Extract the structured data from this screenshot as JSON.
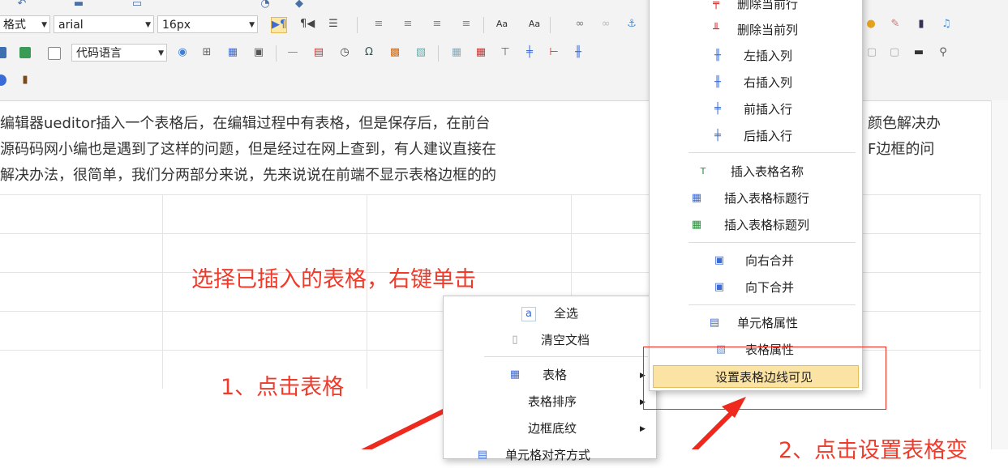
{
  "toolbar": {
    "paragraph_format": "格式",
    "font_family": "arial",
    "font_size": "16px",
    "code_language": "代码语言"
  },
  "editor": {
    "lines": [
      "编辑器ueditor插入一个表格后，在编辑过程中有表格，但是保存后，在前台",
      "源码码网小编也是遇到了这样的问题，但是经过在网上查到，有人建议直接在",
      "解决办法，很简单，我们分两部分来说，先来说说在前端不显示表格边框的的"
    ],
    "right_fragments": [
      "颜色解决办",
      "F边框的问"
    ]
  },
  "annotations": {
    "select_table": "选择已插入的表格，右键单击",
    "step1": "1、点击表格",
    "step2": "2、点击设置表格变"
  },
  "context_menu": {
    "items": [
      {
        "label": "全选",
        "icon": "select-all-icon"
      },
      {
        "label": "清空文档",
        "icon": "document-icon"
      },
      {
        "label": "表格",
        "icon": "table-icon",
        "submenu": true
      },
      {
        "label": "表格排序",
        "submenu": true
      },
      {
        "label": "边框底纹",
        "submenu": true
      },
      {
        "label": "单元格对齐方式",
        "icon": "align-icon"
      }
    ]
  },
  "table_submenu": {
    "items": [
      {
        "label": "删除当前行",
        "icon": "delete-row-icon"
      },
      {
        "label": "删除当前列",
        "icon": "delete-col-icon"
      },
      {
        "label": "左插入列",
        "icon": "insert-col-left-icon"
      },
      {
        "label": "右插入列",
        "icon": "insert-col-right-icon"
      },
      {
        "label": "前插入行",
        "icon": "insert-row-above-icon"
      },
      {
        "label": "后插入行",
        "icon": "insert-row-below-icon"
      },
      {
        "label": "插入表格名称",
        "icon": "insert-caption-icon"
      },
      {
        "label": "插入表格标题行",
        "icon": "insert-title-row-icon"
      },
      {
        "label": "插入表格标题列",
        "icon": "insert-title-col-icon"
      },
      {
        "label": "向右合并",
        "icon": "merge-right-icon"
      },
      {
        "label": "向下合并",
        "icon": "merge-down-icon"
      },
      {
        "label": "单元格属性",
        "icon": "cell-properties-icon"
      },
      {
        "label": "表格属性",
        "icon": "table-properties-icon"
      },
      {
        "label": "设置表格边线可见"
      }
    ]
  },
  "colors": {
    "annotation_red": "#f03a2a",
    "highlight_bg": "#fbe3a4",
    "toolbar_bg": "#f3f3f3"
  }
}
